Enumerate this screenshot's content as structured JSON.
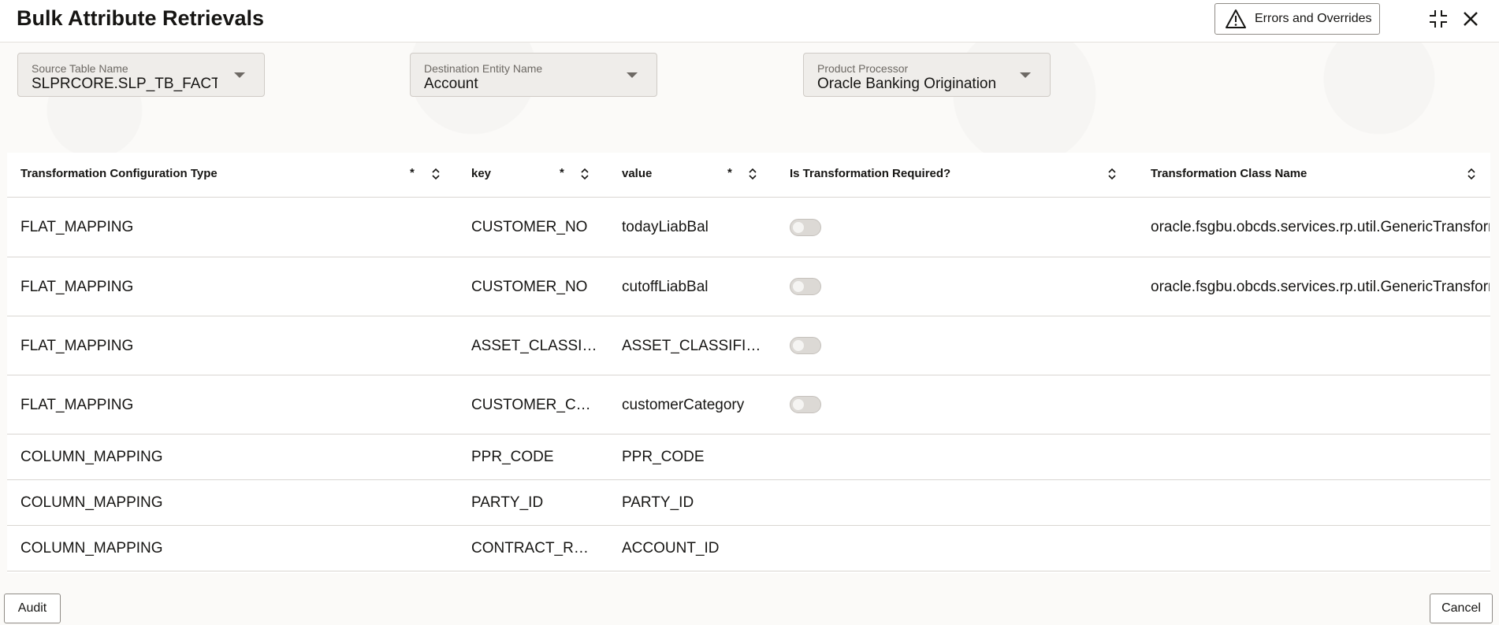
{
  "header": {
    "title": "Bulk Attribute Retrievals",
    "errors_button": "Errors and Overrides"
  },
  "filters": [
    {
      "label": "Source Table Name",
      "value": "SLPRCORE.SLP_TB_FACT_CH"
    },
    {
      "label": "Destination Entity Name",
      "value": "Account"
    },
    {
      "label": "Product Processor",
      "value": "Oracle Banking Origination"
    }
  ],
  "table": {
    "columns": [
      {
        "label": "Transformation Configuration Type",
        "required": "*"
      },
      {
        "label": "key",
        "required": "*"
      },
      {
        "label": "value",
        "required": "*"
      },
      {
        "label": "Is Transformation Required?",
        "required": ""
      },
      {
        "label": "Transformation Class Name",
        "required": ""
      }
    ],
    "rows": [
      {
        "type": "FLAT_MAPPING",
        "key": "CUSTOMER_NO",
        "value": "todayLiabBal",
        "toggle": "off",
        "class_name": "oracle.fsgbu.obcds.services.rp.util.GenericTransformati"
      },
      {
        "type": "FLAT_MAPPING",
        "key": "CUSTOMER_NO",
        "value": "cutoffLiabBal",
        "toggle": "off",
        "class_name": "oracle.fsgbu.obcds.services.rp.util.GenericTransformati"
      },
      {
        "type": "FLAT_MAPPING",
        "key": "ASSET_CLASSIFI...",
        "value": "ASSET_CLASSIFICA...",
        "toggle": "off",
        "class_name": ""
      },
      {
        "type": "FLAT_MAPPING",
        "key": "CUSTOMER_CAT...",
        "value": "customerCategory",
        "toggle": "off",
        "class_name": ""
      },
      {
        "type": "COLUMN_MAPPING",
        "key": "PPR_CODE",
        "value": "PPR_CODE",
        "toggle": "",
        "class_name": ""
      },
      {
        "type": "COLUMN_MAPPING",
        "key": "PARTY_ID",
        "value": "PARTY_ID",
        "toggle": "",
        "class_name": ""
      },
      {
        "type": "COLUMN_MAPPING",
        "key": "CONTRACT_REF...",
        "value": "ACCOUNT_ID",
        "toggle": "",
        "class_name": ""
      }
    ]
  },
  "footer": {
    "audit_button": "Audit",
    "cancel_button": "Cancel"
  }
}
